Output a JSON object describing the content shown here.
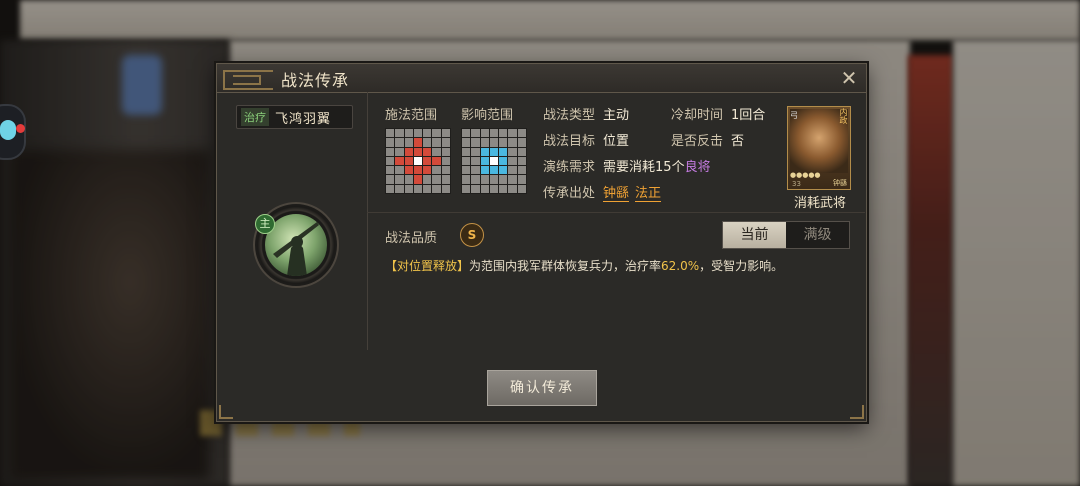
{
  "dialog": {
    "title": "战法传承",
    "close_icon": "close-icon"
  },
  "skill": {
    "type": "治疗",
    "name": "飞鸿羽翼",
    "main_badge": "主"
  },
  "range": {
    "cast_label": "施法范围",
    "effect_label": "影响范围"
  },
  "info": {
    "type_label": "战法类型",
    "type_value": "主动",
    "cooldown_label": "冷却时间",
    "cooldown_value": "1回合",
    "target_label": "战法目标",
    "target_value": "位置",
    "counter_label": "是否反击",
    "counter_value": "否",
    "practice_label": "演练需求",
    "practice_prefix": "需要消耗",
    "practice_count": "15",
    "practice_unit": "个",
    "practice_item": "良将",
    "source_label": "传承出处",
    "source_1": "钟繇",
    "source_2": "法正"
  },
  "general_card": {
    "arm": "弓",
    "tag": "内政",
    "level": "33",
    "name_small": "钟繇",
    "stars": "●●●●●",
    "caption": "消耗武将"
  },
  "quality": {
    "label": "战法品质",
    "grade": "S"
  },
  "toggle": {
    "current": "当前",
    "max": "满级"
  },
  "description": {
    "tag": "【对位置释放】",
    "text_before": "为范围内我军群体恢复兵力，治疗率",
    "rate": "62.0%",
    "text_after": "，受智力影响。"
  },
  "confirm_label": "确认传承",
  "colors": {
    "accent_gold": "#f0a234",
    "heal_green": "#8ad07a",
    "purple": "#c47be0",
    "range_red": "#d34a3a",
    "range_blue": "#4ab8e0"
  }
}
